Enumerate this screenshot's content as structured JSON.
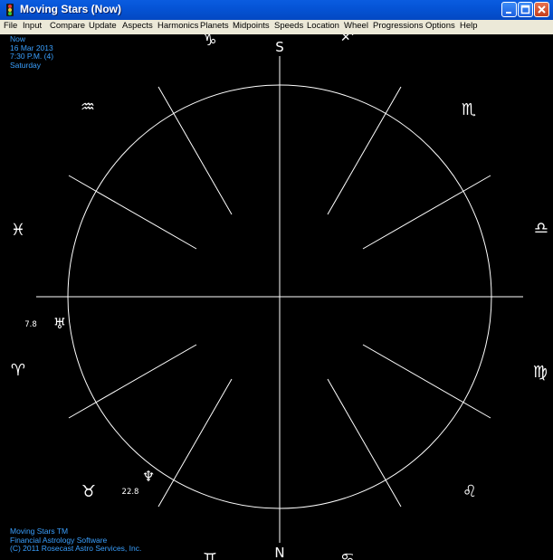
{
  "window": {
    "title": "Moving Stars (Now)"
  },
  "menu": [
    "File",
    "Input",
    "Compare",
    "Update",
    "Aspects",
    "Harmonics",
    "Planets",
    "Midpoints",
    "Speeds",
    "Location",
    "Wheel",
    "Progressions",
    "Options",
    "Help"
  ],
  "header_info": [
    "Now",
    "16 Mar 2013",
    "7:30 P.M. (4)",
    "Saturday"
  ],
  "footer_info": [
    "Moving Stars TM",
    "Financial Astrology Software",
    "(C) 2011 Rosecast Astro Services, Inc."
  ],
  "wheel": {
    "axis_top": "S",
    "axis_bottom": "N",
    "signs": [
      {
        "name": "Capricorn",
        "glyph": "♑"
      },
      {
        "name": "Sagittarius",
        "glyph": "♐"
      },
      {
        "name": "Scorpio",
        "glyph": "♏"
      },
      {
        "name": "Libra",
        "glyph": "♎"
      },
      {
        "name": "Virgo",
        "glyph": "♍"
      },
      {
        "name": "Leo",
        "glyph": "♌"
      },
      {
        "name": "Cancer",
        "glyph": "♋"
      },
      {
        "name": "Gemini",
        "glyph": "♊"
      },
      {
        "name": "Taurus",
        "glyph": "♉"
      },
      {
        "name": "Aries",
        "glyph": "♈"
      },
      {
        "name": "Pisces",
        "glyph": "♓"
      },
      {
        "name": "Aquarius",
        "glyph": "♒"
      }
    ],
    "planets": [
      {
        "name": "Uranus",
        "glyph": "♅",
        "degree": "7.8"
      },
      {
        "name": "Neptune",
        "glyph": "♆",
        "degree": "22.8"
      }
    ]
  },
  "colors": {
    "text_info": "#3aa0ff",
    "wheel": "#ffffff",
    "background": "#000000"
  },
  "icons": [
    "app-icon",
    "minimize-icon",
    "maximize-icon",
    "close-icon"
  ]
}
